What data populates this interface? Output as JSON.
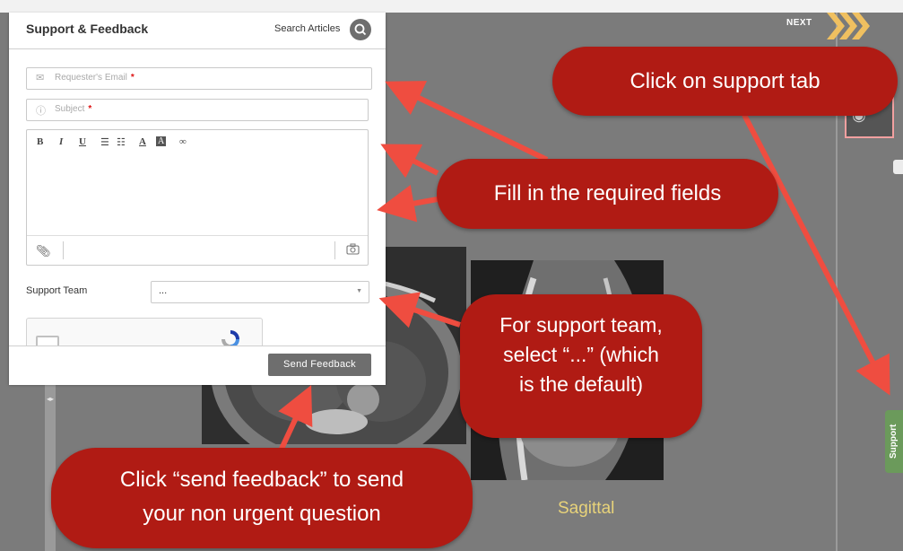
{
  "panel": {
    "title": "Support & Feedback",
    "search_label": "Search Articles",
    "email_placeholder": "Requester's Email",
    "subject_placeholder": "Subject",
    "required_mark": "*",
    "toolbar": {
      "bold": "B",
      "italic": "I",
      "underline": "U",
      "font_color": "A",
      "highlight": "A"
    },
    "team_label": "Support Team",
    "team_value": "...",
    "send_label": "Send Feedback"
  },
  "viewer": {
    "next_label": "NEXT",
    "sagittal_label": "Sagittal",
    "support_tab_label": "Support"
  },
  "callouts": {
    "support_tab": "Click on support tab",
    "required_fields": "Fill in the required fields",
    "team_line1": "For support team,",
    "team_line2": "select “...” (which",
    "team_line3": "is the default)",
    "send_line1": "Click “send feedback” to send",
    "send_line2": "your non urgent question"
  },
  "colors": {
    "callout": "#b01b14",
    "arrow": "#ef4d40",
    "support_tab": "#6b9a5b",
    "next_chevron": "#f0c060",
    "sagittal_label": "#e8d37a"
  }
}
